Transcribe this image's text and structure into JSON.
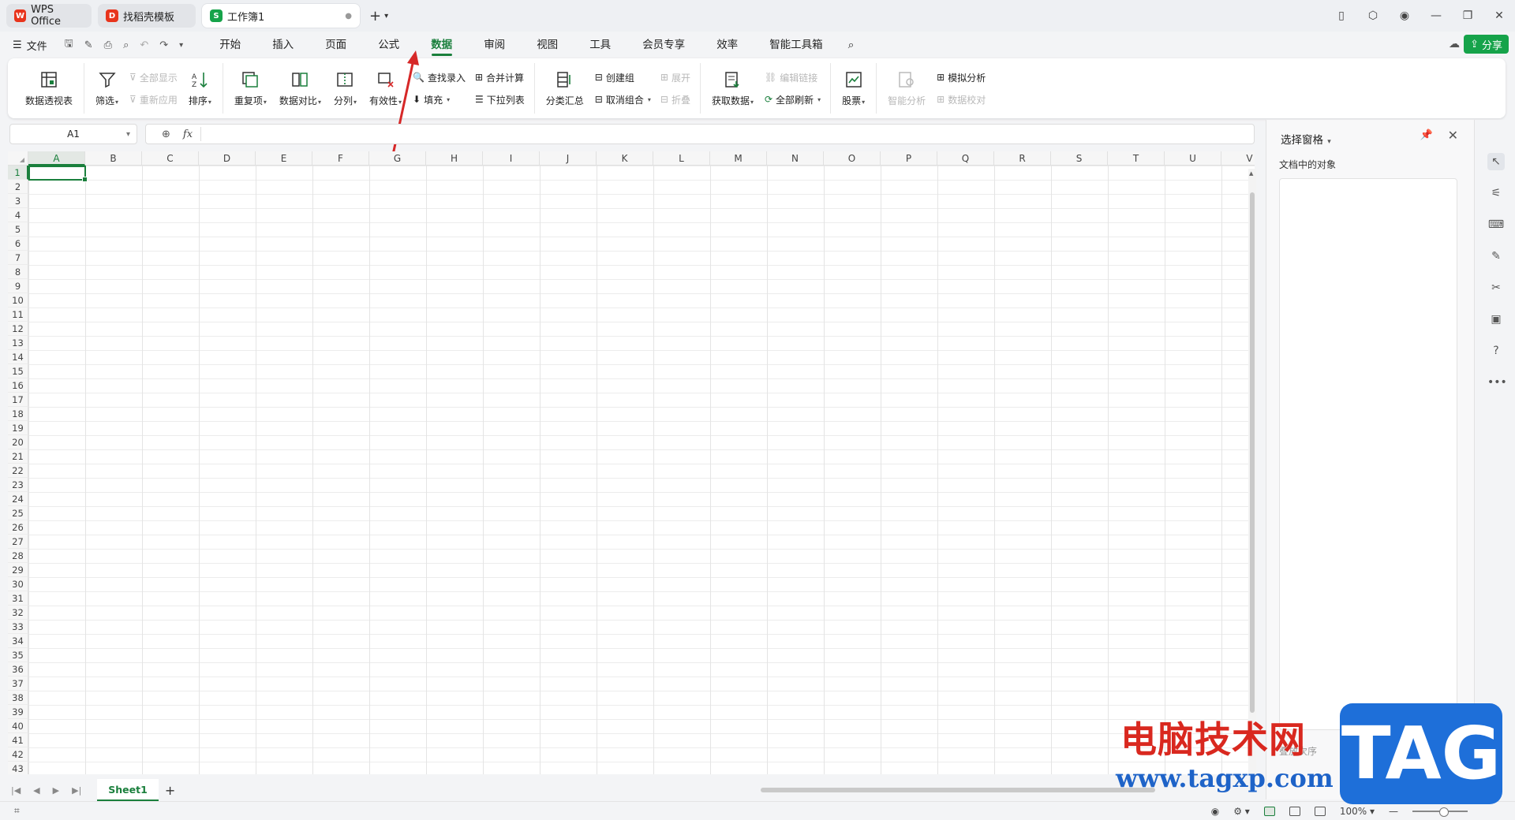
{
  "tabs": [
    {
      "label": "WPS Office",
      "logo_color": "#e8341c",
      "logo": "W"
    },
    {
      "label": "找稻壳模板",
      "logo_color": "#e8341c",
      "logo": "D"
    },
    {
      "label": "工作簿1",
      "logo_color": "#16a34a",
      "logo": "S",
      "active": true
    }
  ],
  "menu": {
    "file": "文件",
    "tabs": [
      "开始",
      "插入",
      "页面",
      "公式",
      "数据",
      "审阅",
      "视图",
      "工具",
      "会员专享",
      "效率",
      "智能工具箱"
    ],
    "active_tab": "数据",
    "share": "分享"
  },
  "ribbon": {
    "pivot": "数据透视表",
    "filter": "筛选",
    "show_all": "全部显示",
    "reapply": "重新应用",
    "sort": "排序",
    "duplicates": "重复项",
    "compare": "数据对比",
    "split": "分列",
    "validity": "有效性",
    "lookup": "查找录入",
    "fill": "填充",
    "consolidate": "合并计算",
    "dropdown": "下拉列表",
    "subtotal": "分类汇总",
    "group": "创建组",
    "ungroup": "取消组合",
    "expand": "展开",
    "collapse": "折叠",
    "get_data": "获取数据",
    "edit_links": "编辑链接",
    "refresh_all": "全部刷新",
    "stocks": "股票",
    "smart_analysis": "智能分析",
    "whatif": "模拟分析",
    "data_check": "数据校对"
  },
  "formula_bar": {
    "cell_ref": "A1",
    "fx": "fx",
    "value": ""
  },
  "grid": {
    "columns": [
      "A",
      "B",
      "C",
      "D",
      "E",
      "F",
      "G",
      "H",
      "I",
      "J",
      "K",
      "L",
      "M",
      "N",
      "O",
      "P",
      "Q",
      "R",
      "S",
      "T",
      "U",
      "V"
    ],
    "row_count": 43,
    "active_col": "A",
    "active_row": 1
  },
  "sheets": {
    "tabs": [
      "Sheet1"
    ],
    "active": "Sheet1"
  },
  "status": {
    "zoom": "100%"
  },
  "pane": {
    "title": "选择窗格",
    "subtitle": "文档中的对象",
    "order_label": "叠放次序"
  },
  "watermark": {
    "text": "电脑技术网",
    "url": "www.tagxp.com",
    "tag": "TAG"
  },
  "colors": {
    "accent": "#1a7f3c",
    "share": "#16a34a",
    "arrow": "#d62828"
  }
}
